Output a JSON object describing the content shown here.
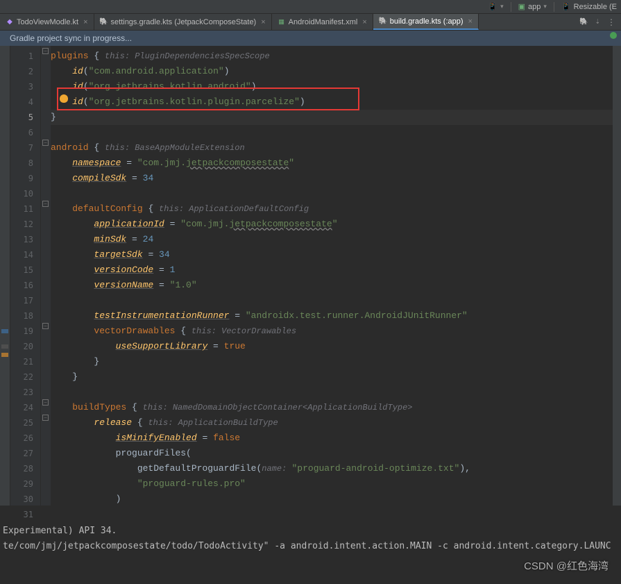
{
  "toolbar": {
    "module": "app",
    "resizable": "Resizable (E"
  },
  "tabs": [
    {
      "label": "TodoViewModle.kt",
      "icon": "kt",
      "active": false
    },
    {
      "label": "settings.gradle.kts (JetpackComposeState)",
      "icon": "gradle",
      "active": false
    },
    {
      "label": "AndroidManifest.xml",
      "icon": "xml",
      "active": false
    },
    {
      "label": "build.gradle.kts (:app)",
      "icon": "gradle",
      "active": true
    }
  ],
  "sync_msg": "Gradle project sync in progress...",
  "gutter": [
    "1",
    "2",
    "3",
    "4",
    "5",
    "6",
    "7",
    "8",
    "9",
    "10",
    "11",
    "12",
    "13",
    "14",
    "15",
    "16",
    "17",
    "18",
    "19",
    "20",
    "21",
    "22",
    "23",
    "24",
    "25",
    "26",
    "27",
    "28",
    "29",
    "30",
    "31"
  ],
  "current_line": 5,
  "code": {
    "l1": {
      "kw": "plugins",
      "br": " { ",
      "hint": "this: PluginDependenciesSpecScope"
    },
    "l2": {
      "pre": "    ",
      "fn": "id",
      "op": "(",
      "str": "\"com.android.application\"",
      "cp": ")"
    },
    "l3": {
      "pre": "    ",
      "fn": "id",
      "op": "(",
      "str": "\"org.jetbrains.kotlin.android\"",
      "cp": ")"
    },
    "l4": {
      "pre": "    ",
      "fn": "id",
      "op": "(",
      "str": "\"org.jetbrains.kotlin.plugin.parcelize\"",
      "cp": ")"
    },
    "l5": {
      "br": "}"
    },
    "l7": {
      "kw": "android",
      "br": " { ",
      "hint": "this: BaseAppModuleExtension"
    },
    "l8": {
      "pre": "    ",
      "name": "namespace",
      "eq": " = ",
      "pre2": "\"com.jmj.",
      "link": "jetpackcomposestate",
      "suf": "\""
    },
    "l9": {
      "pre": "    ",
      "name": "compileSdk",
      "eq": " = ",
      "num": "34"
    },
    "l11": {
      "pre": "    ",
      "kw": "defaultConfig",
      "br": " { ",
      "hint": "this: ApplicationDefaultConfig"
    },
    "l12": {
      "pre": "        ",
      "name": "applicationId",
      "eq": " = ",
      "pre2": "\"com.jmj.",
      "link": "jetpackcomposestate",
      "suf": "\""
    },
    "l13": {
      "pre": "        ",
      "name": "minSdk",
      "eq": " = ",
      "num": "24"
    },
    "l14": {
      "pre": "        ",
      "name": "targetSdk",
      "eq": " = ",
      "num": "34"
    },
    "l15": {
      "pre": "        ",
      "name": "versionCode",
      "eq": " = ",
      "num": "1"
    },
    "l16": {
      "pre": "        ",
      "name": "versionName",
      "eq": " = ",
      "str": "\"1.0\""
    },
    "l18": {
      "pre": "        ",
      "name": "testInstrumentationRunner",
      "eq": " = ",
      "str": "\"androidx.test.runner.AndroidJUnitRunner\""
    },
    "l19": {
      "pre": "        ",
      "kw": "vectorDrawables",
      "br": " { ",
      "hint": "this: VectorDrawables"
    },
    "l20": {
      "pre": "            ",
      "name": "useSupportLibrary",
      "eq": " = ",
      "bool": "true"
    },
    "l21": {
      "pre": "        ",
      "br": "}"
    },
    "l22": {
      "pre": "    ",
      "br": "}"
    },
    "l24": {
      "pre": "    ",
      "kw": "buildTypes",
      "br": " { ",
      "hint": "this: NamedDomainObjectContainer<ApplicationBuildType>"
    },
    "l25": {
      "pre": "        ",
      "fn": "release",
      "br": " { ",
      "hint": "this: ApplicationBuildType"
    },
    "l26": {
      "pre": "            ",
      "name": "isMinifyEnabled",
      "eq": " = ",
      "bool": "false"
    },
    "l27": {
      "pre": "            ",
      "txt": "proguardFiles("
    },
    "l28": {
      "pre": "                ",
      "txt": "getDefaultProguardFile(",
      "hint": "name: ",
      "str": "\"proguard-android-optimize.txt\"",
      "suf": "),"
    },
    "l29": {
      "pre": "                ",
      "str": "\"proguard-rules.pro\""
    },
    "l30": {
      "pre": "            ",
      "txt": ")"
    }
  },
  "console": {
    "l1": "Experimental) API 34.",
    "l2": "te/com/jmj/jetpackcomposestate/todo/TodoActivity\" -a android.intent.action.MAIN -c android.intent.category.LAUNC",
    "l3": ""
  },
  "watermark": "CSDN @红色海湾"
}
